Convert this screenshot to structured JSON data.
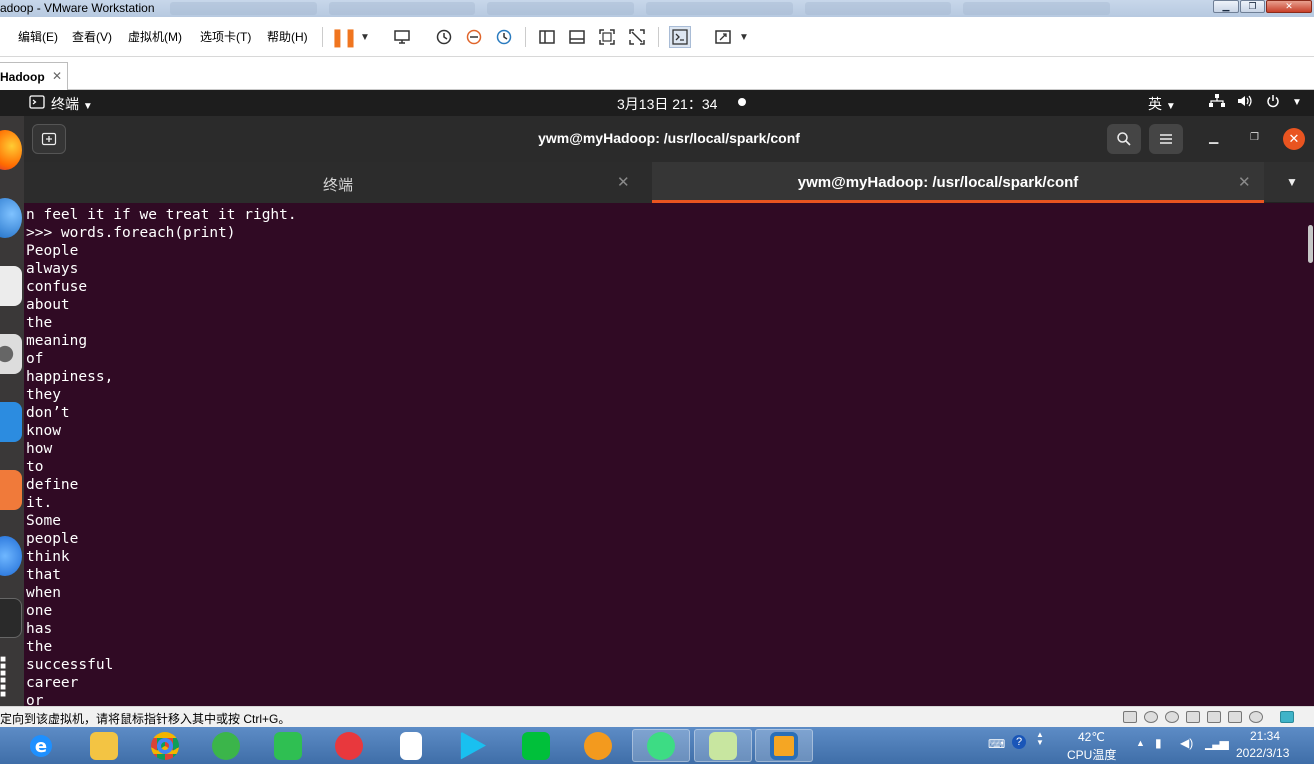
{
  "vmware": {
    "window_title": "adoop - VMware Workstation",
    "menu": [
      "编辑(E)",
      "查看(V)",
      "虚拟机(M)",
      "选项卡(T)",
      "帮助(H)"
    ],
    "vm_tab": "Hadoop",
    "status_message": "定向到该虚拟机，请将鼠标指针移入其中或按 Ctrl+G。"
  },
  "ubuntu": {
    "activities_label": "终端",
    "clock": "3月13日  21：34",
    "input_method": "英"
  },
  "terminal": {
    "window_title": "ywm@myHadoop: /usr/local/spark/conf",
    "tabs": [
      {
        "label": "终端"
      },
      {
        "label": "ywm@myHadoop: /usr/local/spark/conf"
      }
    ],
    "lines": [
      "n feel it if we treat it right.",
      ">>> words.foreach(print)",
      "People",
      "always",
      "confuse",
      "about",
      "the",
      "meaning",
      "of",
      "happiness,",
      "they",
      "don’t",
      "know",
      "how",
      "to",
      "define",
      "it.",
      "Some",
      "people",
      "think",
      "that",
      "when",
      "one",
      "has",
      "the",
      "successful",
      "career",
      "or"
    ]
  },
  "windows_tray": {
    "temperature": "42℃",
    "temperature_label": "CPU温度",
    "time": "21:34",
    "date": "2022/3/13"
  },
  "colors": {
    "terminal_bg": "#300a24",
    "ubuntu_orange": "#e95420",
    "taskbar": "#4a7bb7"
  }
}
